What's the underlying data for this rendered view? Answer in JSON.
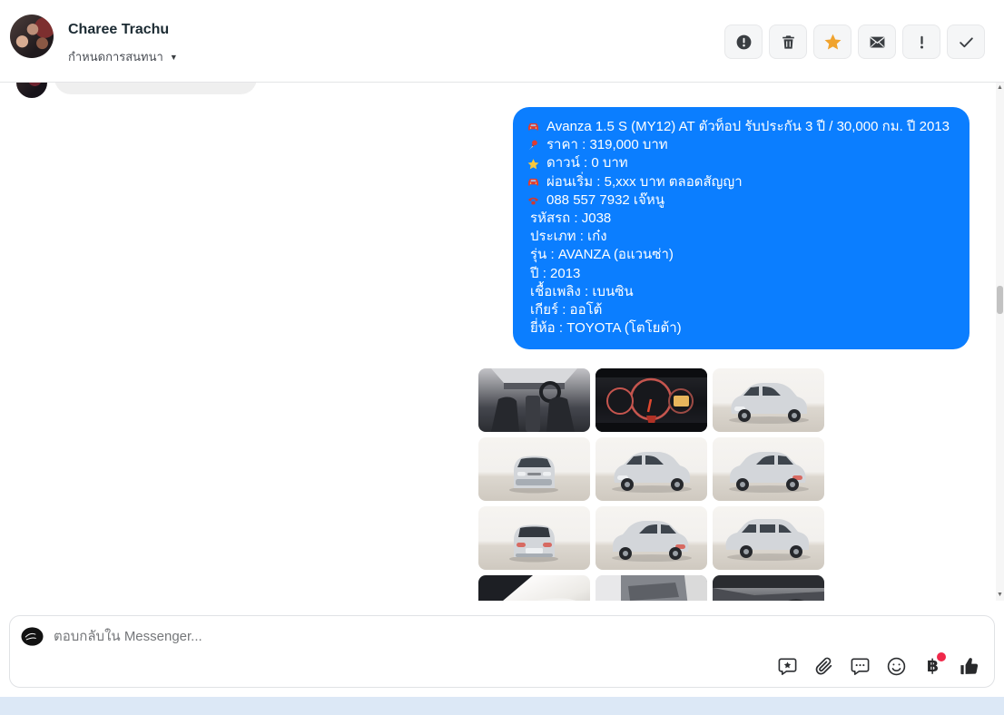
{
  "header": {
    "name": "Charee Trachu",
    "subtitle": "กำหนดการสนทนา",
    "toolbar": [
      {
        "id": "report",
        "icon": "alert-circle-icon"
      },
      {
        "id": "delete",
        "icon": "trash-icon"
      },
      {
        "id": "star",
        "icon": "star-icon",
        "active": true
      },
      {
        "id": "unread",
        "icon": "envelope-icon"
      },
      {
        "id": "important",
        "icon": "exclamation-icon"
      },
      {
        "id": "done",
        "icon": "check-icon"
      }
    ]
  },
  "conversation": {
    "incoming_partial_bubble": true,
    "message": {
      "direction": "outgoing",
      "lines": [
        {
          "icon": "car",
          "text": "Avanza 1.5 S (MY12) AT ตัวท็อป รับประกัน 3 ปี / 30,000 กม. ปี 2013"
        },
        {
          "icon": "pin",
          "text": "ราคา : 319,000 บาท"
        },
        {
          "icon": "star",
          "text": "ดาวน์ : 0 บาท"
        },
        {
          "icon": "car",
          "text": "ผ่อนเริ่ม : 5,xxx บาท ตลอดสัญญา"
        },
        {
          "icon": "phone",
          "text": "088 557 7932 เจ๊หนู"
        },
        {
          "icon": null,
          "text": "รหัสรถ : J038"
        },
        {
          "icon": null,
          "text": "ประเภท : เก๋ง"
        },
        {
          "icon": null,
          "text": "รุ่น : AVANZA (อแวนซ่า)"
        },
        {
          "icon": null,
          "text": "ปี : 2013"
        },
        {
          "icon": null,
          "text": "เชื้อเพลิง : เบนซิน"
        },
        {
          "icon": null,
          "text": "เกียร์ : ออโต้"
        },
        {
          "icon": null,
          "text": "ยี่ห้อ : TOYOTA (โตโยต้า)"
        }
      ]
    },
    "photos": [
      {
        "name": "photo-interior-dashboard",
        "variant": "interior"
      },
      {
        "name": "photo-gauge-cluster",
        "variant": "gauges"
      },
      {
        "name": "photo-front-quarter",
        "variant": "ext-front-quarter"
      },
      {
        "name": "photo-front-view",
        "variant": "ext-front"
      },
      {
        "name": "photo-front-quarter-2",
        "variant": "ext-front-quarter"
      },
      {
        "name": "photo-rear-quarter",
        "variant": "ext-rear-quarter"
      },
      {
        "name": "photo-rear-view",
        "variant": "ext-rear"
      },
      {
        "name": "photo-rear-quarter-2",
        "variant": "ext-rear-quarter"
      },
      {
        "name": "photo-side-view",
        "variant": "ext-side"
      },
      {
        "name": "photo-body-closeup",
        "variant": "closeup-body"
      },
      {
        "name": "photo-door-panel",
        "variant": "closeup-door"
      },
      {
        "name": "photo-dash-closeup",
        "variant": "closeup-dash"
      }
    ]
  },
  "composer": {
    "placeholder": "ตอบกลับใน Messenger...",
    "actions": [
      {
        "id": "saved-replies",
        "icon": "comment-star-icon"
      },
      {
        "id": "attach",
        "icon": "paperclip-icon"
      },
      {
        "id": "sticker",
        "icon": "comment-dots-icon"
      },
      {
        "id": "emoji",
        "icon": "smiley-icon"
      },
      {
        "id": "payment",
        "icon": "baht-icon",
        "badge": true
      },
      {
        "id": "like",
        "icon": "thumbs-up-icon"
      }
    ]
  },
  "colors": {
    "bubble_blue": "#0b7eff",
    "bubble_text": "#ffffff",
    "star_accent": "#f0a32e",
    "badge_red": "#f0284a",
    "bottom_strip": "#dce8f6"
  }
}
